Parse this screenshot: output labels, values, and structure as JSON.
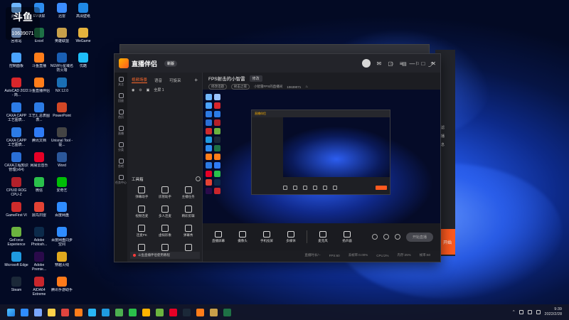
{
  "desktop": {
    "icons": [
      {
        "label": "此电脑",
        "color": "#6fb6ff"
      },
      {
        "label": "回收站",
        "color": "#9bc4ff"
      },
      {
        "label": "控制面板",
        "color": "#4aa3ff"
      },
      {
        "label": "AutoCAD 2022 - 简...",
        "color": "#d9262b"
      },
      {
        "label": "CAXA CAPP 工艺图表...",
        "color": "#2c7be5"
      },
      {
        "label": "CAXA CAPP 工艺图表...",
        "color": "#2c7be5"
      },
      {
        "label": "CAXA工程知识管理(x64)",
        "color": "#2a6fd6"
      },
      {
        "label": "CPUID ROG CPU-Z",
        "color": "#b3202a"
      },
      {
        "label": "GameFirst VI",
        "color": "#cf2b2b"
      },
      {
        "label": "GeForce Experience",
        "color": "#6cb33f"
      },
      {
        "label": "Microsoft Edge",
        "color": "#1f9ae0"
      },
      {
        "label": "Steam",
        "color": "#1b2838"
      },
      {
        "label": "EV录屏",
        "color": "#2d8cf0"
      },
      {
        "label": "Excel",
        "color": "#1e7145"
      },
      {
        "label": "斗鱼直播",
        "color": "#ff7d1a"
      },
      {
        "label": "斗鱼直播伴侣",
        "color": "#ff7d1a"
      },
      {
        "label": "工艺汇总表图表...",
        "color": "#2c7be5"
      },
      {
        "label": "腾讯文档",
        "color": "#2f7bf5"
      },
      {
        "label": "网易云音乐",
        "color": "#e60026"
      },
      {
        "label": "微信",
        "color": "#2ac04b"
      },
      {
        "label": "鼎鸟扫雷",
        "color": "#e34234"
      },
      {
        "label": "Adobe Photosh...",
        "color": "#0c2a4a"
      },
      {
        "label": "Adobe Premie...",
        "color": "#2a0a4a"
      },
      {
        "label": "AIDA64 Extreme",
        "color": "#c9262c"
      },
      {
        "label": "迅雷",
        "color": "#3b8cff"
      },
      {
        "label": "英雄联盟",
        "color": "#c8a04a"
      },
      {
        "label": "NGW行星域名防火墙",
        "color": "#1a5fb4"
      },
      {
        "label": "NX 12.0",
        "color": "#1a6fb4"
      },
      {
        "label": "PowerPoint",
        "color": "#d24726"
      },
      {
        "label": "Unisnal Tool - 驱...",
        "color": "#444"
      },
      {
        "label": "Word",
        "color": "#2b579a"
      },
      {
        "label": "爱奇艺",
        "color": "#00be06"
      },
      {
        "label": "百度网盘",
        "color": "#2f8cff"
      },
      {
        "label": "百度网盘同步空间",
        "color": "#2f8cff"
      },
      {
        "label": "穿越火线",
        "color": "#e0a81e"
      },
      {
        "label": "腾讯手游助手",
        "color": "#ff7a1a"
      },
      {
        "label": "高清壁纸",
        "color": "#1f88e5"
      },
      {
        "label": "WeGame",
        "color": "#e4b23d"
      },
      {
        "label": "优酷",
        "color": "#1ebefa"
      }
    ],
    "overlay_logo": "斗鱼",
    "overlay_room": "10639071"
  },
  "window": {
    "app_name": "直播伴侣",
    "version_badge": "新版",
    "nav": [
      "关注",
      "回放",
      "首页",
      "直播",
      "分类",
      "鱼吧",
      "任务中心"
    ],
    "scene_tabs": [
      "视频场景",
      "语音",
      "可旋采",
      "+"
    ],
    "scene_name": "全屏 1",
    "tools_title": "工具箱",
    "tools": [
      "弹幕助手",
      "房管助手",
      "主播任务",
      "视频连麦",
      "多人连麦",
      "精彩剪辑",
      "连麦PK",
      "虚拟形象",
      "弹幕秀",
      "互动游戏",
      "贴纸",
      "美颜"
    ],
    "notice": "斗鱼直播伴侣使用教程",
    "stream_title": "FPS射击的小智雷",
    "edit_label": "修改",
    "stream_meta": [
      "修改话题",
      "射击之夜",
      "小智雷FPS的直播间",
      "10639071"
    ],
    "controls": [
      "直播屏幕",
      "摄像头",
      "手机投屏",
      "多媒体",
      "麦克风",
      "扬声器"
    ],
    "start_label": "开始直播",
    "status": [
      "直播时长/--",
      "FPS:60",
      "丢帧率:0.00%",
      "CPU:2%",
      "内存:25%",
      "帧率:60"
    ],
    "side_tabs": [
      "过滤",
      "主播",
      "信息"
    ],
    "side_start": "开始"
  },
  "taskbar": {
    "time": "9:39",
    "date": "2022/2/28",
    "icon_colors": [
      "#2f8cff",
      "#7aa7ff",
      "#ffd24a",
      "#e0443e",
      "#ff7d1a",
      "#29b6f6",
      "#1f9ae0",
      "#4caf50",
      "#2ac04b",
      "#ffb300",
      "#6cb33f",
      "#e60026",
      "#1b2838",
      "#ff7d1a",
      "#c8a04a",
      "#1e7145"
    ]
  }
}
